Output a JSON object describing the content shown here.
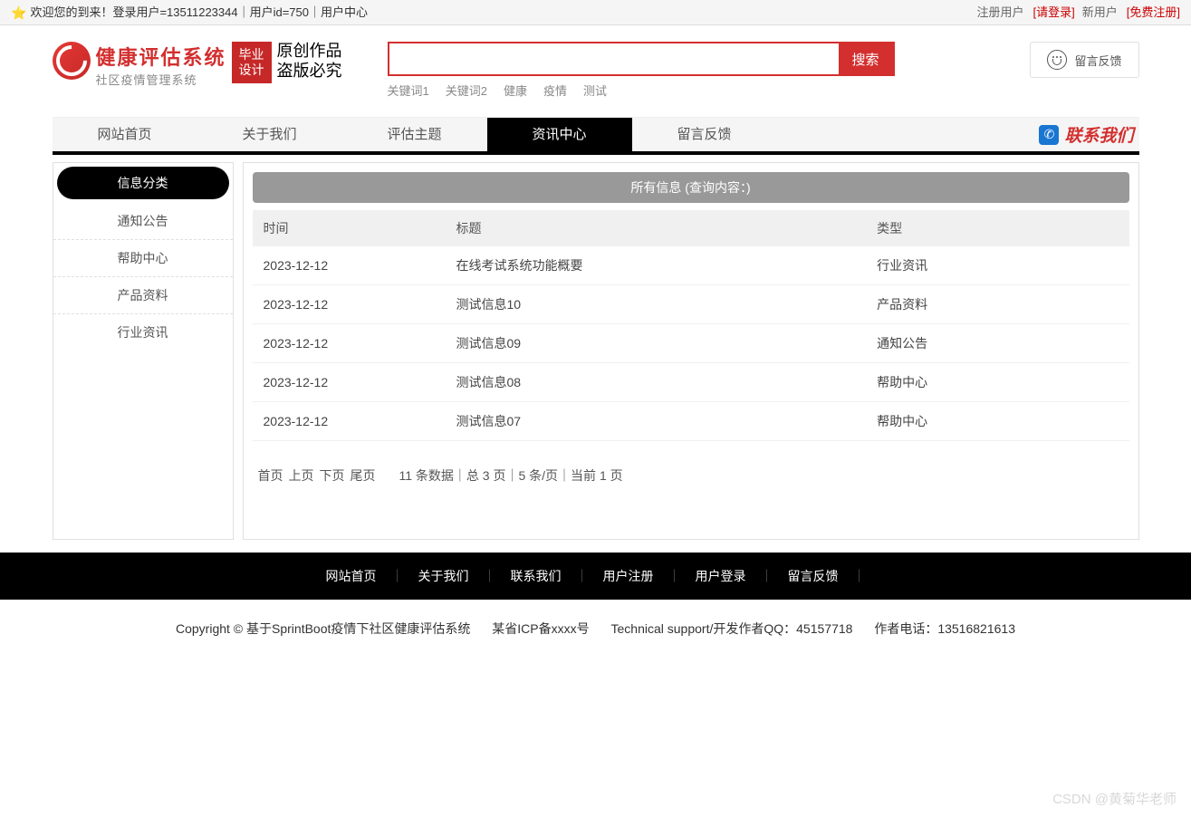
{
  "topbar": {
    "star": "⭐",
    "welcome": "欢迎您的到来！登录用户=13511223344｜用户id=750｜用户中心",
    "registered_label": "注册用户",
    "login_link": "[请登录]",
    "new_user_label": "新用户",
    "register_link": "[免费注册]"
  },
  "logo": {
    "title": "健康评估系统",
    "subtitle": "社区疫情管理系统",
    "badge_line1": "毕业",
    "badge_line2": "设计",
    "script_line1": "原创作品",
    "script_line2": "盗版必究"
  },
  "search": {
    "button": "搜索",
    "value": "",
    "keywords": [
      "关键词1",
      "关键词2",
      "健康",
      "疫情",
      "测试"
    ]
  },
  "feedback_button": "留言反馈",
  "nav": {
    "items": [
      "网站首页",
      "关于我们",
      "评估主题",
      "资讯中心",
      "留言反馈"
    ],
    "active_index": 3,
    "contact": "联系我们",
    "contact_glyph": "✆"
  },
  "sidebar": {
    "title": "信息分类",
    "items": [
      "通知公告",
      "帮助中心",
      "产品资料",
      "行业资讯"
    ]
  },
  "main": {
    "header": "所有信息 (查询内容：)",
    "columns": {
      "time": "时间",
      "title": "标题",
      "type": "类型"
    },
    "rows": [
      {
        "time": "2023-12-12",
        "title": "在线考试系统功能概要",
        "type": "行业资讯"
      },
      {
        "time": "2023-12-12",
        "title": "测试信息10",
        "type": "产品资料"
      },
      {
        "time": "2023-12-12",
        "title": "测试信息09",
        "type": "通知公告"
      },
      {
        "time": "2023-12-12",
        "title": "测试信息08",
        "type": "帮助中心"
      },
      {
        "time": "2023-12-12",
        "title": "测试信息07",
        "type": "帮助中心"
      }
    ],
    "pagination": {
      "first": "首页",
      "prev": "上页",
      "next": "下页",
      "last": "尾页",
      "info": "11 条数据｜总 3 页｜5 条/页｜当前 1 页"
    }
  },
  "footer_nav": [
    "网站首页",
    "关于我们",
    "联系我们",
    "用户注册",
    "用户登录",
    "留言反馈"
  ],
  "footer_sep": "｜",
  "copyright": {
    "c1": "Copyright © 基于SprintBoot疫情下社区健康评估系统",
    "c2": "某省ICP备xxxx号",
    "c3": "Technical support/开发作者QQ：45157718",
    "c4": "作者电话：13516821613"
  },
  "watermark": "CSDN @黄菊华老师"
}
